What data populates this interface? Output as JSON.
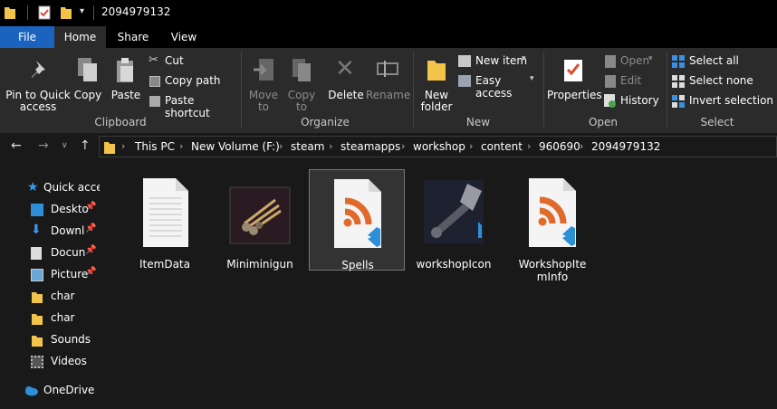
{
  "window": {
    "title": "2094979132"
  },
  "tabs": {
    "file": "File",
    "home": "Home",
    "share": "Share",
    "view": "View"
  },
  "ribbon": {
    "clipboard": {
      "pin": "Pin to Quick access",
      "copy": "Copy",
      "paste": "Paste",
      "cut": "Cut",
      "copy_path": "Copy path",
      "paste_shortcut": "Paste shortcut",
      "label": "Clipboard"
    },
    "organize": {
      "move_to": "Move to",
      "copy_to": "Copy to",
      "delete": "Delete",
      "rename": "Rename",
      "label": "Organize"
    },
    "new": {
      "new_folder": "New folder",
      "new_item": "New item",
      "easy_access": "Easy access",
      "label": "New"
    },
    "open": {
      "properties": "Properties",
      "open": "Open",
      "edit": "Edit",
      "history": "History",
      "label": "Open"
    },
    "select": {
      "select_all": "Select all",
      "select_none": "Select none",
      "invert": "Invert selection",
      "label": "Select"
    }
  },
  "address": {
    "crumbs": [
      "This PC",
      "New Volume (F:)",
      "steam",
      "steamapps",
      "workshop",
      "content",
      "960690",
      "2094979132"
    ]
  },
  "sidebar": {
    "items": [
      {
        "label": "Quick acce"
      },
      {
        "label": "Deskto"
      },
      {
        "label": "Downl"
      },
      {
        "label": "Docun"
      },
      {
        "label": "Picture"
      },
      {
        "label": "char"
      },
      {
        "label": "char"
      },
      {
        "label": "Sounds"
      },
      {
        "label": "Videos"
      },
      {
        "label": "OneDrive"
      }
    ]
  },
  "files": [
    {
      "name": "ItemData",
      "icon": "text-file-icon"
    },
    {
      "name": "Miniminigun",
      "icon": "image-thumbnail-icon"
    },
    {
      "name": "Spells",
      "icon": "rss-vscode-file-icon"
    },
    {
      "name": "workshopIcon",
      "icon": "image-thumbnail-icon"
    },
    {
      "name": "WorkshopItemInfo",
      "icon": "rss-vscode-file-icon"
    }
  ],
  "colors": {
    "accent": "#1a64c0",
    "rss_orange": "#e06a2b",
    "vscode_blue": "#2c8fd8"
  }
}
